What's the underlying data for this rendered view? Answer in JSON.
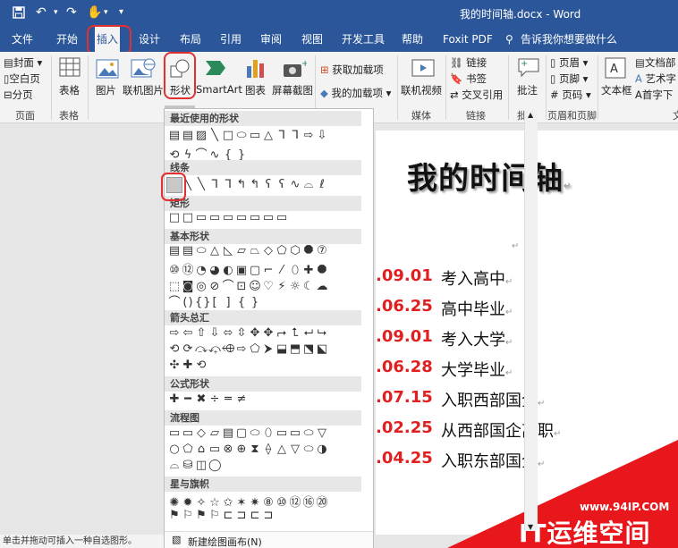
{
  "window": {
    "title": "我的时间轴.docx - Word"
  },
  "qat": {
    "save_icon": "save-icon",
    "undo_icon": "undo-icon",
    "redo_icon": "redo-icon",
    "touch_icon": "touch-mode-icon",
    "customize": "▾"
  },
  "menu": {
    "tabs": [
      "文件",
      "开始",
      "插入",
      "设计",
      "布局",
      "引用",
      "审阅",
      "视图",
      "开发工具",
      "帮助",
      "Foxit PDF"
    ],
    "tell_me": "告诉我你想要做什么",
    "active_tab": "插入"
  },
  "ribbon": {
    "pages": {
      "cover": "封面",
      "blank": "空白页",
      "break": "分页",
      "label": "页面"
    },
    "tables": {
      "table": "表格",
      "label": "表格"
    },
    "illustrations": {
      "pictures": "图片",
      "online_pictures": "联机图片",
      "shapes": "形状",
      "smartart": "SmartArt",
      "chart": "图表",
      "screenshot": "屏幕截图"
    },
    "addins": {
      "get": "获取加载项",
      "my": "我的加载项"
    },
    "media": {
      "online_video": "联机视频",
      "label": "媒体"
    },
    "links": {
      "link": "链接",
      "bookmark": "书签",
      "cross_ref": "交叉引用",
      "label": "链接"
    },
    "comments": {
      "comment": "批注",
      "label": "批注"
    },
    "header_footer": {
      "header": "页眉",
      "footer": "页脚",
      "page_number": "页码",
      "label": "页眉和页脚"
    },
    "text": {
      "textbox": "文本框",
      "quick_parts": "文档部",
      "wordart": "艺术字",
      "dropcap": "首字下",
      "label_partial": "文"
    }
  },
  "shapes_panel": {
    "categories": [
      "最近使用的形状",
      "线条",
      "矩形",
      "基本形状",
      "箭头总汇",
      "公式形状",
      "流程图",
      "星与旗帜"
    ],
    "rows": {
      "recent_1": [
        "▤",
        "▤",
        "▨",
        "╲",
        "□",
        "⬭",
        "▭",
        "△",
        "ᒣ",
        "ᒣ",
        "⇨",
        "⇩"
      ],
      "recent_2": [
        "⟲",
        "ϟ",
        "⌒",
        "∿",
        "{",
        "}"
      ],
      "lines": [
        "▨",
        "╲",
        "╲",
        "ᒣ",
        "ᒣ",
        "↰",
        "↰",
        "ʕ",
        "ʕ",
        "∿",
        "⌓",
        "ℓ"
      ],
      "rect": [
        "□",
        "□",
        "▭",
        "▭",
        "▭",
        "▭",
        "▭",
        "▭",
        "▭"
      ],
      "basic_1": [
        "▤",
        "▤",
        "⬭",
        "△",
        "◺",
        "▱",
        "⏢",
        "◇",
        "⬠",
        "⬡",
        "⯃",
        "⑦"
      ],
      "basic_2": [
        "⑩",
        "⑫",
        "◔",
        "◕",
        "◐",
        "▣",
        "▢",
        "⌐",
        "⁄",
        "⬯",
        "✚",
        "⯃"
      ],
      "basic_3": [
        "⬚",
        "◙",
        "◎",
        "⊘",
        "⌒",
        "⊡",
        "☺",
        "♡",
        "⚡",
        "☼",
        "☾",
        "☁"
      ],
      "basic_4": [
        "⌒",
        "()",
        "{}",
        "[",
        "]",
        "{",
        "}"
      ],
      "arrows_1": [
        "⇨",
        "⇦",
        "⇧",
        "⇩",
        "⬄",
        "⇳",
        "✥",
        "✥",
        "⮣",
        "⮤",
        "⮠",
        "⮡"
      ],
      "arrows_2": [
        "⟲",
        "⟳",
        "⤼",
        "⤽",
        "⬲",
        "⇨",
        "⬠",
        "⮞",
        "⬓",
        "⬒",
        "⬔",
        "⬕"
      ],
      "arrows_3": [
        "✣",
        "✚",
        "⟲"
      ],
      "equation": [
        "✚",
        "━",
        "✖",
        "÷",
        "═",
        "≠"
      ],
      "flow_1": [
        "▭",
        "▭",
        "◇",
        "▱",
        "▤",
        "▢",
        "⬭",
        "⬯",
        "▭",
        "▭",
        "⬭",
        "▽"
      ],
      "flow_2": [
        "○",
        "⬠",
        "⌂",
        "▭",
        "⊗",
        "⊕",
        "⧗",
        "⟠",
        "△",
        "▽",
        "⬭",
        "◑"
      ],
      "flow_3": [
        "⌓",
        "⛁",
        "◫",
        "◯"
      ],
      "stars_1": [
        "✺",
        "✹",
        "✧",
        "☆",
        "✩",
        "✶",
        "✷",
        "⑧",
        "⑩",
        "⑫",
        "⑯",
        "⑳"
      ],
      "stars_2": [
        "⚑",
        "⚐",
        "⚑",
        "⚐",
        "⊏",
        "⊐",
        "⊏",
        "⊐"
      ]
    },
    "new_canvas": "新建绘图画布(N)"
  },
  "document": {
    "heading": "我的时间轴",
    "entries": [
      {
        "date": ".09.01",
        "event": "考入高中"
      },
      {
        "date": ".06.25",
        "event": "高中毕业"
      },
      {
        "date": ".09.01",
        "event": "考入大学"
      },
      {
        "date": ".06.28",
        "event": "大学毕业"
      },
      {
        "date": ".07.15",
        "event": "入职西部国企"
      },
      {
        "date": ".02.25",
        "event": "从西部国企离职"
      },
      {
        "date": ".04.25",
        "event": "入职东部国企"
      }
    ]
  },
  "status": {
    "text": "单击并拖动可插入一种自选图形。"
  },
  "watermark": {
    "url": "www.94IP.COM",
    "brand": "IT运维空间"
  },
  "colors": {
    "title_bar": "#2b579a",
    "ribbon": "#f3f3f3",
    "highlight": "#e03030",
    "date_red": "#e02020",
    "watermark": "#e8171c"
  }
}
